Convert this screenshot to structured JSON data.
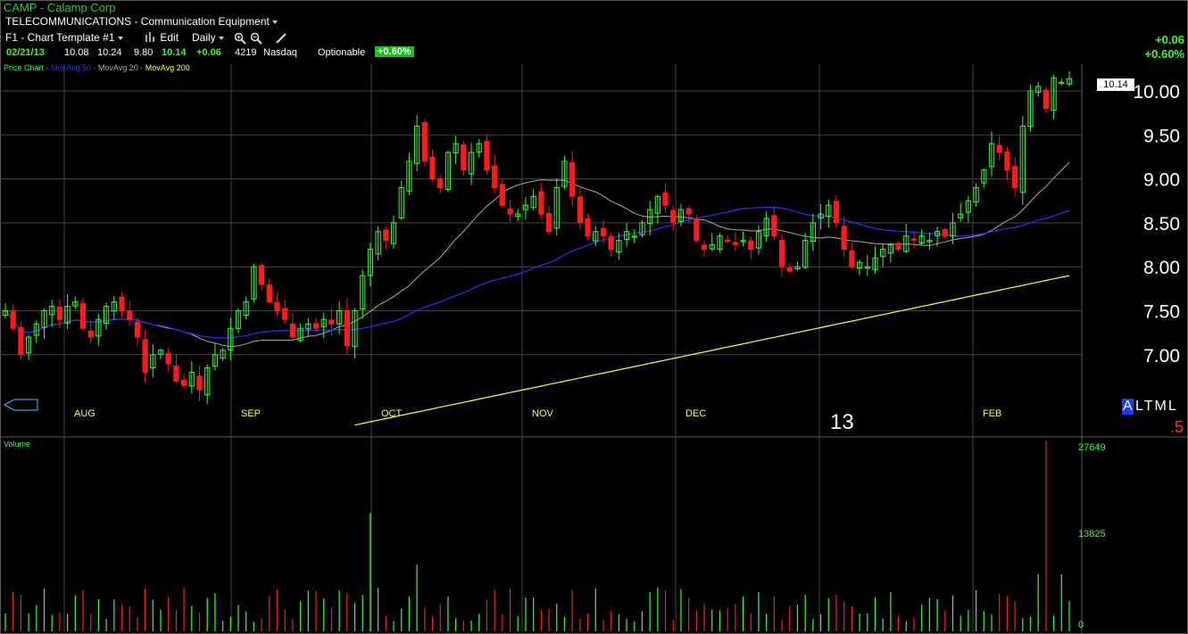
{
  "header": {
    "symbol_title": "CAMP - Calamp Corp",
    "industry": "TELECOMMUNICATIONS - Communication Equipment",
    "template": "F1 - Chart Template #1",
    "edit_label": "Edit",
    "period_label": "Daily",
    "zoom_in_icon": "zoom-in-icon",
    "zoom_out_icon": "zoom-out-icon",
    "draw_icon": "pencil-icon"
  },
  "quote": {
    "date": "02/21/13",
    "open": "10.08",
    "high": "10.24",
    "low": "9.80",
    "close": "10.14",
    "change": "+0.06",
    "volume": "4219",
    "exchange": "Nasdaq",
    "optionable": "Optionable",
    "pct_change": "+0.60%"
  },
  "change_display": {
    "abs": "+0.06",
    "pct": "+0.60%"
  },
  "legend": {
    "price": "Price Chart",
    "ma50": "MovAvg 50",
    "ma20": "MovAvg 20",
    "ma200": "MovAvg 200"
  },
  "badges": {
    "a": "A",
    "ltml": "LTML",
    "five": ".5",
    "year": "13"
  },
  "colors": {
    "up": "#33ff33",
    "down": "#ff1a1a",
    "ma20": "#aaaaaa",
    "ma50": "#2233ff",
    "ma200": "#ffff33",
    "grid": "#444444"
  },
  "chart_data": {
    "type": "candlestick",
    "title": "CAMP - Calamp Corp",
    "y_axis": {
      "ticks": [
        "7.00",
        "7.50",
        "8.00",
        "8.50",
        "9.00",
        "9.50",
        "10.00"
      ],
      "range": [
        6.6,
        10.4
      ]
    },
    "last_price_label": "10.14",
    "months": [
      "AUG",
      "SEP",
      "OCT",
      "NOV",
      "DEC",
      "13",
      "FEB"
    ],
    "closes": [
      7.5,
      7.3,
      7.0,
      7.2,
      7.35,
      7.5,
      7.55,
      7.4,
      7.55,
      7.6,
      7.3,
      7.2,
      7.4,
      7.55,
      7.6,
      7.5,
      7.4,
      7.2,
      6.8,
      7.0,
      7.05,
      6.9,
      6.7,
      6.65,
      6.8,
      6.6,
      6.85,
      7.0,
      7.05,
      7.3,
      7.5,
      7.6,
      8.0,
      7.8,
      7.6,
      7.5,
      7.4,
      7.2,
      7.3,
      7.35,
      7.3,
      7.4,
      7.35,
      7.5,
      7.1,
      7.5,
      7.9,
      8.2,
      8.4,
      8.3,
      8.5,
      8.9,
      9.2,
      9.6,
      9.2,
      9.0,
      8.9,
      9.3,
      9.4,
      9.1,
      9.3,
      9.4,
      9.1,
      8.9,
      8.7,
      8.6,
      8.6,
      8.7,
      8.8,
      8.6,
      8.4,
      8.9,
      9.2,
      8.8,
      8.5,
      8.35,
      8.4,
      8.35,
      8.2,
      8.3,
      8.4,
      8.35,
      8.5,
      8.65,
      8.8,
      8.7,
      8.5,
      8.65,
      8.6,
      8.3,
      8.2,
      8.25,
      8.35,
      8.3,
      8.25,
      8.3,
      8.2,
      8.4,
      8.55,
      8.35,
      8.0,
      7.95,
      8.0,
      8.3,
      8.5,
      8.6,
      8.7,
      8.5,
      8.2,
      8.0,
      8.05,
      8.0,
      8.1,
      8.2,
      8.25,
      8.2,
      8.35,
      8.3,
      8.35,
      8.3,
      8.4,
      8.35,
      8.5,
      8.6,
      8.75,
      8.9,
      9.1,
      9.4,
      9.3,
      9.1,
      8.9,
      9.6,
      10.0,
      10.05,
      9.8,
      10.15,
      10.1,
      10.14
    ],
    "volume_axis": [
      "27649",
      "13825",
      "0"
    ]
  }
}
